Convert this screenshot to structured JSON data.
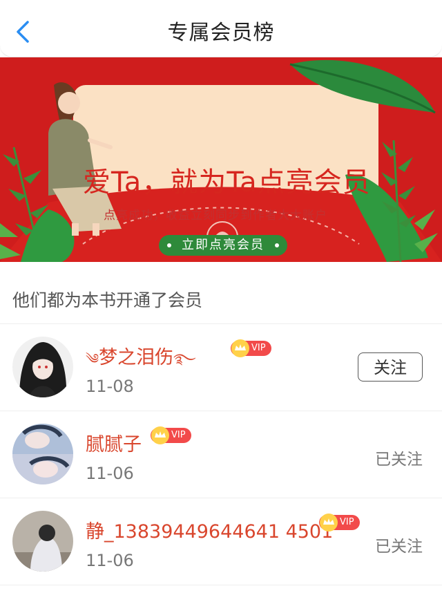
{
  "header": {
    "title": "专属会员榜"
  },
  "banner": {
    "title": "爱Ta，就为Ta点亮会员",
    "subtitle": "点亮成功，收益立刻同步到作者大大账户",
    "button_label": "立即点亮会员"
  },
  "section": {
    "title": "他们都为本书开通了会员"
  },
  "members": [
    {
      "name": "梦之泪伤",
      "vip": "VIP",
      "date": "11-08",
      "action": "关注"
    },
    {
      "name": "腻腻子",
      "vip": "VIP",
      "date": "11-06",
      "action": "已关注"
    },
    {
      "name": "静_13839449644641 4501",
      "vip": "VIP",
      "date": "11-06",
      "action": "已关注"
    }
  ],
  "colors": {
    "brand_red": "#cf1d1d",
    "accent_green": "#2e8a3a",
    "name_color": "#d9462d",
    "back_blue": "#2a8df2"
  }
}
